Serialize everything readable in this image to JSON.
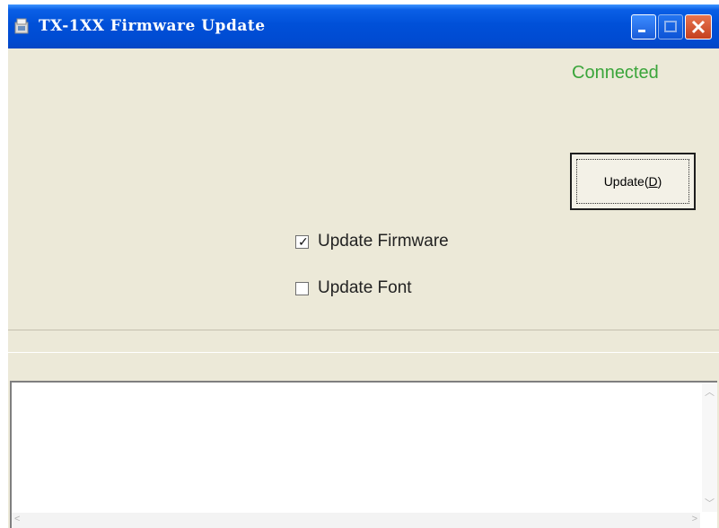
{
  "window": {
    "title": "TX-1XX Firmware Update",
    "buttons": {
      "minimize": "minimize-icon",
      "maximize": "maximize-icon",
      "close": "close-icon"
    }
  },
  "status": {
    "text": "Connected",
    "color": "#3aa53a"
  },
  "update_button": {
    "label_prefix": "Update(",
    "mnemonic": "D",
    "label_suffix": ")"
  },
  "options": [
    {
      "label": "Update Firmware",
      "checked": true
    },
    {
      "label": "Update Font",
      "checked": false
    }
  ],
  "log": {
    "text": ""
  },
  "colors": {
    "titlebar": "#0050d8",
    "dialog_bg": "#ece9d8",
    "status_green": "#3aa53a"
  }
}
